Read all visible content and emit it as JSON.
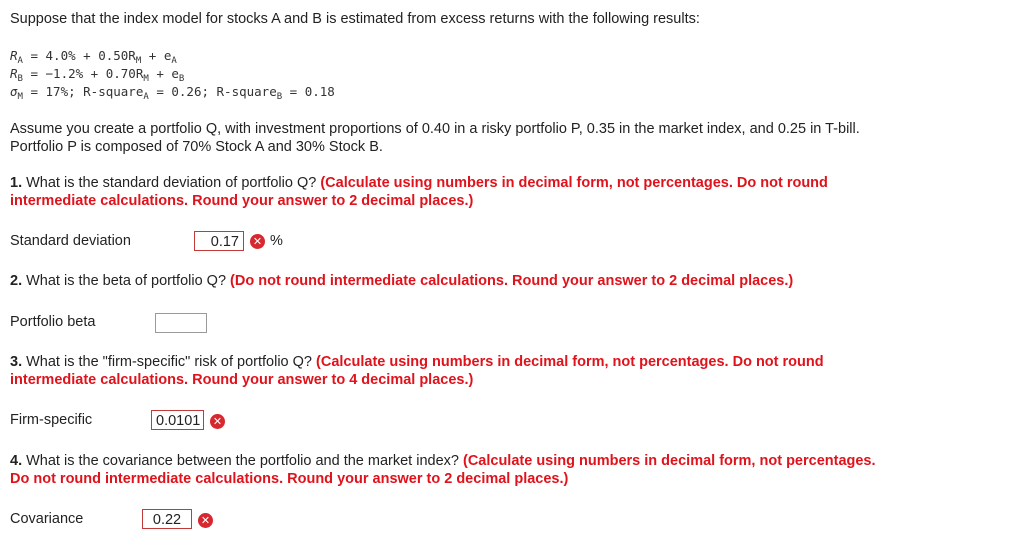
{
  "intro": "Suppose that the index model for stocks A and B is estimated from excess returns with the following results:",
  "equations": {
    "ra": {
      "lhs": "R",
      "lhs_sub": "A",
      "rest1": " = 4.0% + 0.50R",
      "sub1": "M",
      "rest2": " + e",
      "sub2": "A"
    },
    "rb": {
      "lhs": "R",
      "lhs_sub": "B",
      "rest1": " = −1.2% + 0.70R",
      "sub1": "M",
      "rest2": " + e",
      "sub2": "B"
    },
    "sm": {
      "lhs": "σ",
      "lhs_sub": "M",
      "rest1": " = 17%; R-square",
      "sub1": "A",
      "rest2": " = 0.26; R-square",
      "sub2": "B",
      "rest3": " = 0.18"
    }
  },
  "assume_line1": "Assume you create a portfolio Q, with investment proportions of 0.40 in a risky portfolio P, 0.35 in the market index, and 0.25 in T-bill.",
  "assume_line2": "Portfolio P is composed of 70% Stock A and 30% Stock B.",
  "questions": [
    {
      "num": "1.",
      "text": " What is the standard deviation of portfolio Q? ",
      "instruction_l1": "(Calculate using numbers in decimal form, not percentages. Do not round",
      "instruction_l2": "intermediate calculations. Round your answer to 2 decimal places.)",
      "label": "Standard deviation",
      "value": "0.17",
      "unit": "%"
    },
    {
      "num": "2.",
      "text": " What is the beta of portfolio Q? ",
      "instruction_l1": "(Do not round intermediate calculations. Round your answer to 2 decimal places.)",
      "label": "Portfolio beta",
      "value": ""
    },
    {
      "num": "3.",
      "text": " What is the \"firm-specific\" risk of portfolio Q? ",
      "instruction_l1": "(Calculate using numbers in decimal form, not percentages. Do not round",
      "instruction_l2": "intermediate calculations. Round your answer to 4 decimal places.)",
      "label": "Firm-specific",
      "value": "0.0101"
    },
    {
      "num": "4.",
      "text": " What is the covariance between the portfolio and the market index? ",
      "instruction_l1": "(Calculate using numbers in decimal form, not percentages.",
      "instruction_l2": "Do not round intermediate calculations. Round your answer to 2 decimal places.)",
      "label": "Covariance",
      "value": "0.22"
    }
  ],
  "colors": {
    "instruction": "#e0121b",
    "incorrect_icon": "#d8282f"
  },
  "icons": {
    "incorrect": "x-circle-icon"
  }
}
